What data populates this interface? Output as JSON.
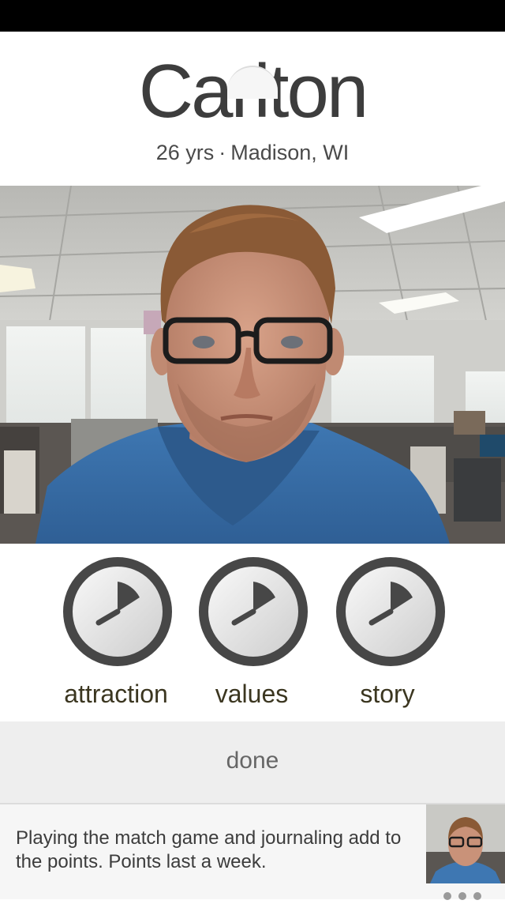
{
  "profile": {
    "name": "Carlton",
    "age": "26 yrs",
    "separator": "·",
    "location": "Madison, WI"
  },
  "photo": {
    "alt_subject": "profile-photo"
  },
  "dials": [
    {
      "label": "attraction",
      "icon": "dial-icon"
    },
    {
      "label": "values",
      "icon": "dial-icon"
    },
    {
      "label": "story",
      "icon": "dial-icon"
    }
  ],
  "done_label": "done",
  "tip": {
    "text": "Playing the match game and journaling add to the points. Points last a week."
  },
  "colors": {
    "dial_ring": "#474747",
    "dial_fill_light": "#fafafa",
    "dial_fill_dark": "#cfcfcf",
    "done_bar": "#eeeeee"
  }
}
